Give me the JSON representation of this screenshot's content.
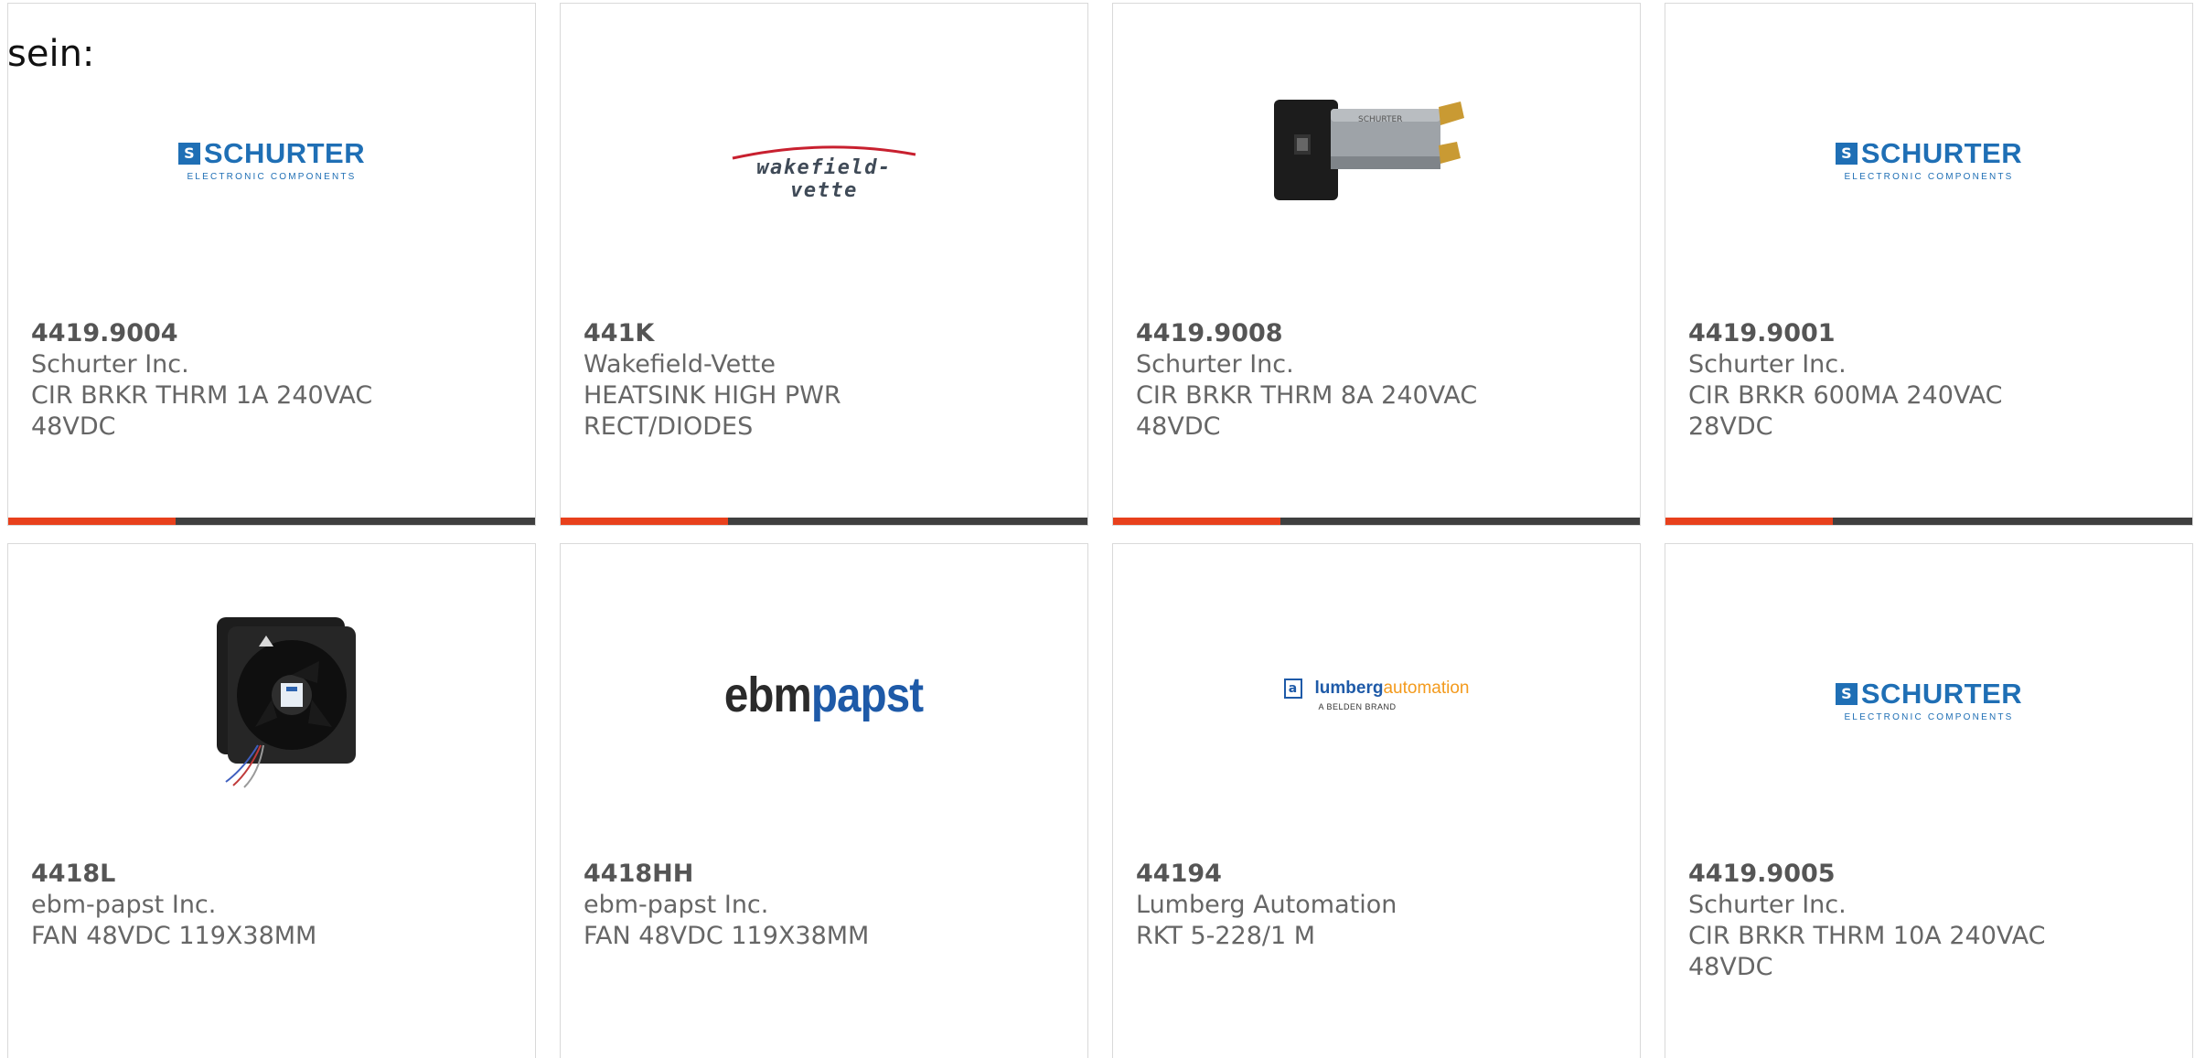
{
  "intro_text": "sein:",
  "colors": {
    "accent": "#e8401c",
    "bar": "#3f3f3f",
    "schurter_blue": "#1f6fb5",
    "papst_blue": "#1e5aa8",
    "lumberg_orange": "#f39a1c"
  },
  "products": [
    {
      "part_number": "4419.9004",
      "manufacturer": "Schurter Inc.",
      "description": "CIR BRKR THRM 1A 240VAC 48VDC",
      "image": "schurter-logo",
      "logo_text": "SCHURTER",
      "logo_sub": "ELECTRONIC COMPONENTS"
    },
    {
      "part_number": "441K",
      "manufacturer": "Wakefield-Vette",
      "description": "HEATSINK HIGH PWR RECT/DIODES",
      "image": "wakefield-vette-logo",
      "logo_text": "wakefield-vette"
    },
    {
      "part_number": "4419.9008",
      "manufacturer": "Schurter Inc.",
      "description": "CIR BRKR THRM 8A 240VAC 48VDC",
      "image": "circuit-breaker-photo"
    },
    {
      "part_number": "4419.9001",
      "manufacturer": "Schurter Inc.",
      "description": "CIR BRKR 600MA 240VAC 28VDC",
      "image": "schurter-logo",
      "logo_text": "SCHURTER",
      "logo_sub": "ELECTRONIC COMPONENTS"
    },
    {
      "part_number": "4418L",
      "manufacturer": "ebm-papst Inc.",
      "description": "FAN 48VDC 119X38MM",
      "image": "fan-photo"
    },
    {
      "part_number": "4418HH",
      "manufacturer": "ebm-papst Inc.",
      "description": "FAN 48VDC 119X38MM",
      "image": "ebmpapst-logo",
      "logo_ebm": "ebm",
      "logo_papst": "papst"
    },
    {
      "part_number": "44194",
      "manufacturer": "Lumberg Automation",
      "description": "RKT 5-228/1 M",
      "image": "lumberg-automation-logo",
      "logo_lumberg": "lumberg",
      "logo_automation": "automation",
      "logo_tag": "A BELDEN BRAND"
    },
    {
      "part_number": "4419.9005",
      "manufacturer": "Schurter Inc.",
      "description": "CIR BRKR THRM 10A 240VAC 48VDC",
      "image": "schurter-logo",
      "logo_text": "SCHURTER",
      "logo_sub": "ELECTRONIC COMPONENTS"
    }
  ]
}
